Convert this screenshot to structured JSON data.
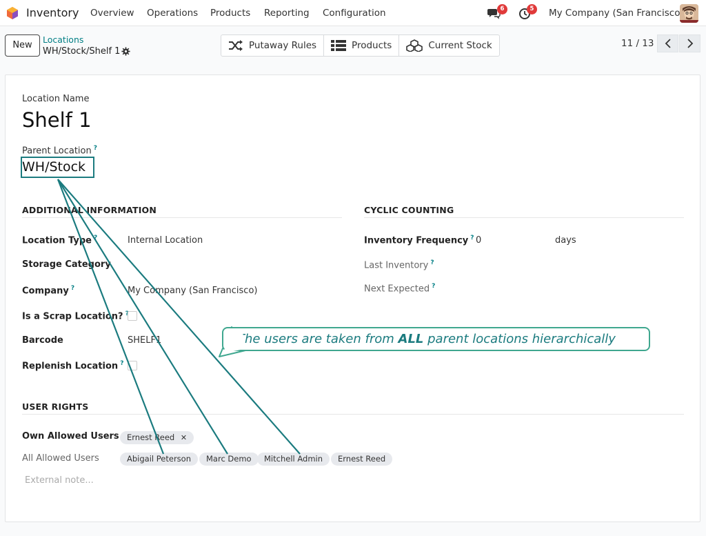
{
  "navbar": {
    "app_name": "Inventory",
    "menu": [
      "Overview",
      "Operations",
      "Products",
      "Reporting",
      "Configuration"
    ],
    "messages_badge": "6",
    "activities_badge": "5",
    "company": "My Company (San Francisco)"
  },
  "control": {
    "new_label": "New",
    "breadcrumb_parent": "Locations",
    "breadcrumb_current": "WH/Stock/Shelf 1",
    "smart_buttons": [
      "Putaway Rules",
      "Products",
      "Current Stock"
    ],
    "pager": "11 / 13"
  },
  "form": {
    "name_label": "Location Name",
    "name_value": "Shelf 1",
    "parent_label": "Parent Location",
    "parent_value": "WH/Stock",
    "help_mark": "?",
    "additional": {
      "title": "ADDITIONAL INFORMATION",
      "location_type_label": "Location Type",
      "location_type_value": "Internal Location",
      "storage_category_label": "Storage Category",
      "company_label": "Company",
      "company_value": "My Company (San Francisco)",
      "scrap_label": "Is a Scrap Location?",
      "barcode_label": "Barcode",
      "barcode_value": "SHELF1",
      "replenish_label": "Replenish Location"
    },
    "cyclic": {
      "title": "CYCLIC COUNTING",
      "frequency_label": "Inventory Frequency",
      "frequency_value": "0",
      "frequency_unit": "days",
      "last_inventory_label": "Last Inventory",
      "next_expected_label": "Next Expected"
    },
    "user_rights": {
      "title": "USER RIGHTS",
      "own_label": "Own Allowed Users",
      "own_users": [
        "Ernest Reed"
      ],
      "all_label": "All Allowed Users",
      "all_users": [
        "Abigail Peterson",
        "Marc Demo",
        "Mitchell Admin",
        "Ernest Reed"
      ],
      "remove_glyph": "✕"
    },
    "note_placeholder": "External note..."
  },
  "annotation": {
    "text_before": "The users are taken from ",
    "text_emphasis": "ALL",
    "text_after": " parent locations hierarchically"
  },
  "colors": {
    "accent": "#017e84",
    "annotation": "#1b7b7f",
    "badge": "#e03a3a"
  }
}
